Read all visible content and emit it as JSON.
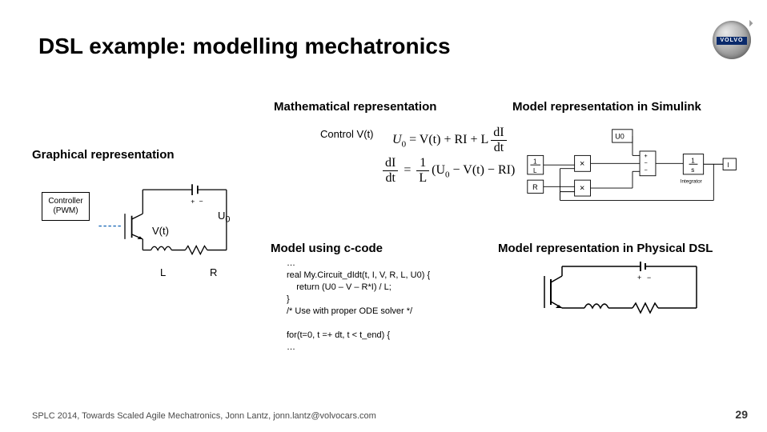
{
  "title": "DSL example: modelling mechatronics",
  "logo_text": "VOLVO",
  "sections": {
    "graphical": "Graphical representation",
    "math": "Mathematical representation",
    "simulink": "Model representation in Simulink",
    "ccode": "Model using c-code",
    "physdsl": "Model representation in Physical DSL"
  },
  "graphical": {
    "controller": "Controller\n(PWM)",
    "vt": "V(t)",
    "u0": "U",
    "u0_sub": "0",
    "L": "L",
    "R": "R"
  },
  "math": {
    "control_label": "Control V(t)",
    "eq1_lhs": "U",
    "eq1_sub": "0",
    "eq1_rhs": " = V(t) + RI + L",
    "frac1_num": "dI",
    "frac1_den": "dt",
    "eq2_frac_lhs_n": "dI",
    "eq2_frac_lhs_d": "dt",
    "eq2_mid": " = ",
    "eq2_frac_1L_n": "1",
    "eq2_frac_1L_d": "L",
    "eq2_paren": "(U",
    "eq2_paren_sub": "0",
    "eq2_paren2": " − V(t) − RI)"
  },
  "simulink": {
    "u0_block": "U0",
    "one_over_L": "1\nL",
    "R_block": "R",
    "integrator_num": "1",
    "integrator_den": "s",
    "integrator_label": "Integrator",
    "mult1": "×",
    "mult2": "×",
    "sum": "+\n−\n−",
    "out": "I"
  },
  "ccode": "…\nreal My.Circuit_dIdt(t, I, V, R, L, U0) {\n    return (U0 – V – R*I) / L;\n}\n/* Use with proper ODE solver */\n\nfor(t=0, t =+ dt, t < t_end) {\n…",
  "footer": "SPLC 2014, Towards Scaled Agile Mechatronics, Jonn Lantz, jonn.lantz@volvocars.com",
  "page_number": "29"
}
